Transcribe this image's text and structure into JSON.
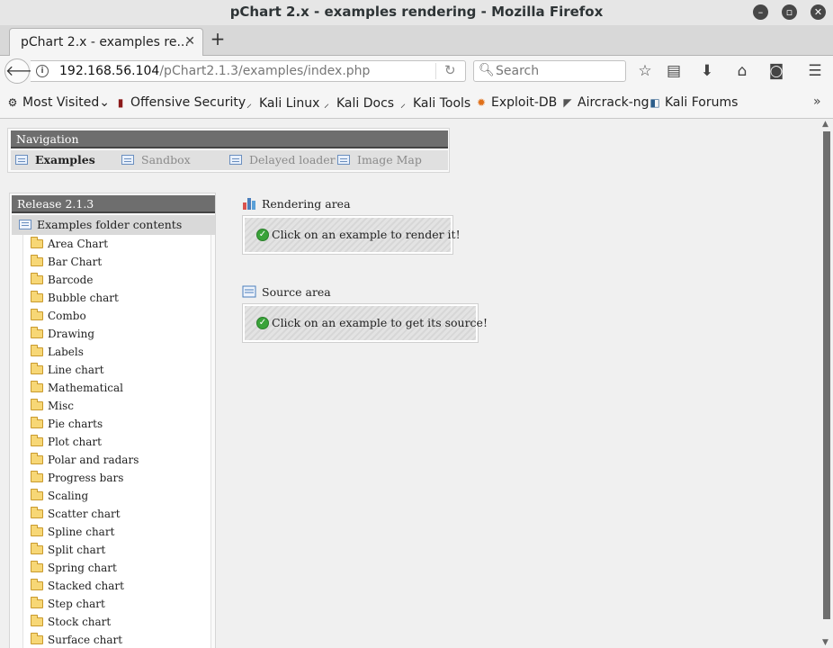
{
  "window": {
    "title": "pChart 2.x - examples rendering - Mozilla Firefox"
  },
  "tab": {
    "label": "pChart 2.x - examples re...",
    "close": "✕",
    "new_tab": "+"
  },
  "navbar": {
    "url_host": "192.168.56.104",
    "url_path": "/pChart2.1.3/examples/index.php",
    "search_placeholder": "Search"
  },
  "bookmarks": [
    {
      "label": "Most Visited",
      "icon": "gear-icon",
      "suffix": "⌄"
    },
    {
      "label": "Offensive Security",
      "icon": "offsec-icon"
    },
    {
      "label": "Kali Linux",
      "icon": "kali-dragon-icon"
    },
    {
      "label": "Kali Docs",
      "icon": "kali-dragon-icon"
    },
    {
      "label": "Kali Tools",
      "icon": "kali-dragon-icon"
    },
    {
      "label": "Exploit-DB",
      "icon": "exploit-db-icon"
    },
    {
      "label": "Aircrack-ng",
      "icon": "aircrack-icon"
    },
    {
      "label": "Kali Forums",
      "icon": "kali-forums-icon"
    }
  ],
  "nav_panel": {
    "title": "Navigation",
    "items": [
      {
        "label": "Examples",
        "active": true
      },
      {
        "label": "Sandbox",
        "active": false
      },
      {
        "label": "Delayed loader",
        "active": false
      },
      {
        "label": "Image Map",
        "active": false
      }
    ]
  },
  "release_panel": {
    "title": "Release 2.1.3",
    "folder_header": "Examples folder contents",
    "folders": [
      "Area Chart",
      "Bar Chart",
      "Barcode",
      "Bubble chart",
      "Combo",
      "Drawing",
      "Labels",
      "Line chart",
      "Mathematical",
      "Misc",
      "Pie charts",
      "Plot chart",
      "Polar and radars",
      "Progress bars",
      "Scaling",
      "Scatter chart",
      "Spline chart",
      "Split chart",
      "Spring chart",
      "Stacked chart",
      "Step chart",
      "Stock chart",
      "Surface chart"
    ]
  },
  "rendering_area": {
    "title": "Rendering area",
    "message": "Click on an example to render it!"
  },
  "source_area": {
    "title": "Source area",
    "message": "Click on an example to get its source!"
  }
}
